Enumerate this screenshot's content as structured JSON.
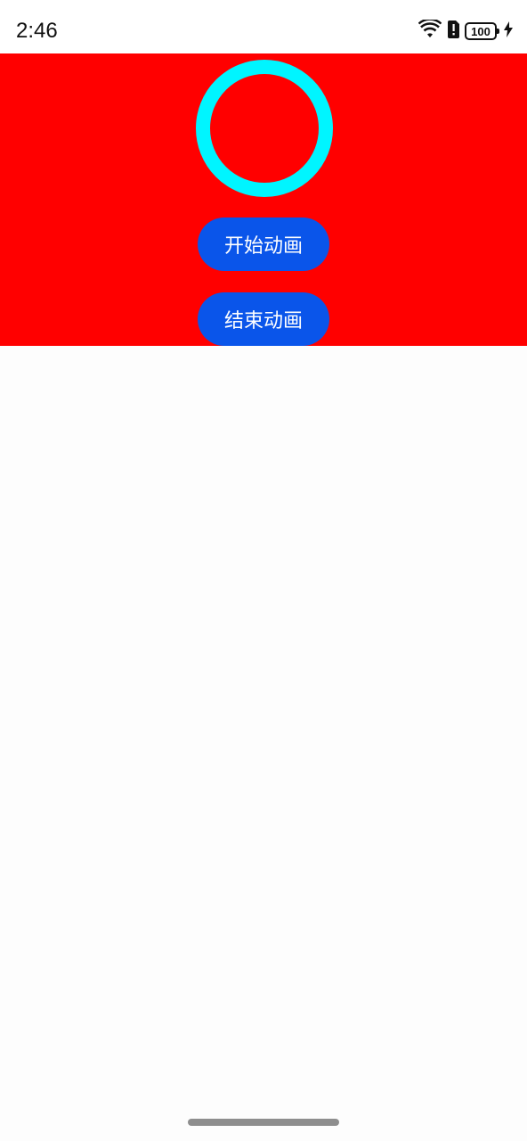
{
  "status_bar": {
    "time": "2:46",
    "battery_level": "100",
    "icons": [
      "wifi-icon",
      "sim-alert-icon",
      "battery-icon",
      "charging-icon"
    ]
  },
  "panel": {
    "background_color": "#ff0000",
    "ring_color": "#00f5ff"
  },
  "buttons": {
    "start_label": "开始动画",
    "end_label": "结束动画",
    "color": "#0a55ea"
  }
}
